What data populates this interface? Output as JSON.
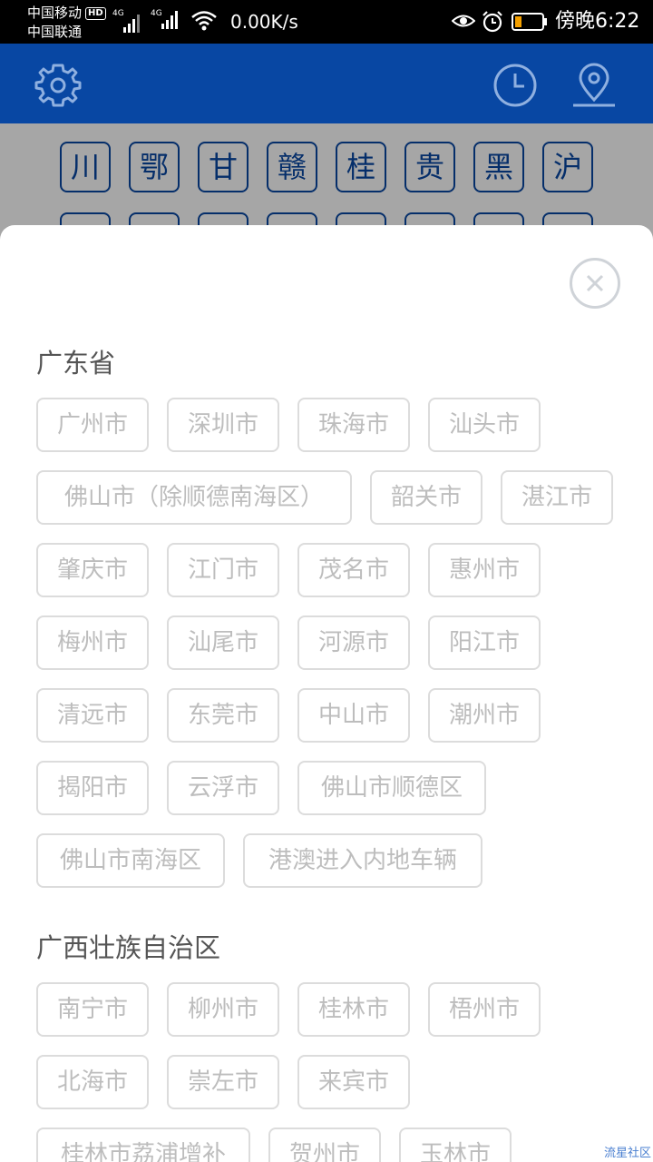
{
  "statusbar": {
    "carrier1": "中国移动",
    "hd": "HD",
    "carrier2": "中国联通",
    "net1": "4G",
    "net2": "4G",
    "speed": "0.00K/s",
    "time": "傍晚6:22"
  },
  "header": {
    "settings_icon": "gear-icon",
    "history_icon": "clock-icon",
    "location_icon": "map-pin-icon",
    "color": "#0847a3"
  },
  "provinces": [
    "川",
    "鄂",
    "甘",
    "赣",
    "桂",
    "贵",
    "黑",
    "沪"
  ],
  "sheet": {
    "sections": [
      {
        "title": "广东省",
        "cities": [
          "广州市",
          "深圳市",
          "珠海市",
          "汕头市",
          "佛山市（除顺德南海区）",
          "韶关市",
          "湛江市",
          "肇庆市",
          "江门市",
          "茂名市",
          "惠州市",
          "梅州市",
          "汕尾市",
          "河源市",
          "阳江市",
          "清远市",
          "东莞市",
          "中山市",
          "潮州市",
          "揭阳市",
          "云浮市",
          "佛山市顺德区",
          "佛山市南海区",
          "港澳进入内地车辆"
        ]
      },
      {
        "title": "广西壮族自治区",
        "cities": [
          "南宁市",
          "柳州市",
          "桂林市",
          "梧州市",
          "北海市",
          "崇左市",
          "来宾市",
          "桂林市荔浦增补",
          "贺州市",
          "玉林市"
        ]
      }
    ]
  },
  "watermark": "流星社区"
}
